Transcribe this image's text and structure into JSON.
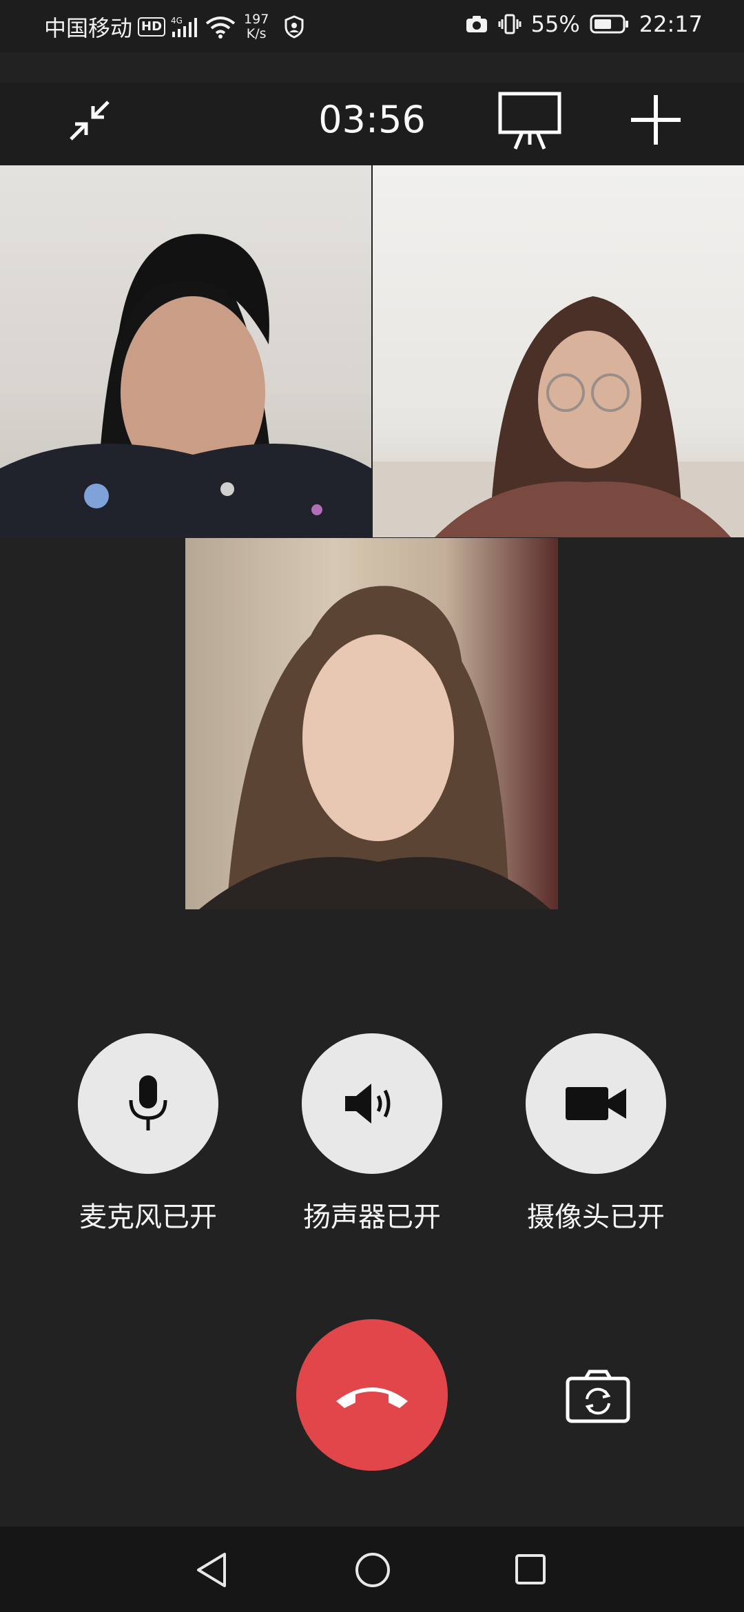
{
  "status_bar": {
    "carrier": "中国移动",
    "hd": "HD",
    "network": "4G",
    "speed_value": "197",
    "speed_unit": "K/s",
    "battery": "55%",
    "time": "22:17"
  },
  "call": {
    "duration": "03:56"
  },
  "controls": {
    "mic_label": "麦克风已开",
    "speaker_label": "扬声器已开",
    "camera_label": "摄像头已开"
  },
  "icons": {
    "minimize": "minimize-icon",
    "whiteboard": "whiteboard-icon",
    "add": "plus-icon",
    "mic": "microphone-icon",
    "speaker": "speaker-icon",
    "camera": "video-camera-icon",
    "hangup": "hang-up-icon",
    "switch_camera": "switch-camera-icon"
  },
  "colors": {
    "background": "#222222",
    "hangup": "#e0464a",
    "control_circle": "#e8e8e8"
  }
}
